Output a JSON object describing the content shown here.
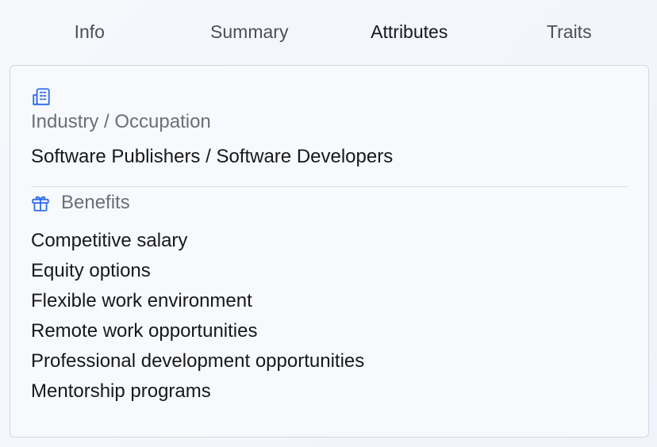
{
  "tabs": [
    {
      "label": "Info",
      "active": false
    },
    {
      "label": "Summary",
      "active": false
    },
    {
      "label": "Attributes",
      "active": true
    },
    {
      "label": "Traits",
      "active": false
    }
  ],
  "industry": {
    "icon": "building-icon",
    "label": "Industry / Occupation",
    "value": "Software Publishers / Software Developers"
  },
  "benefits": {
    "icon": "gift-icon",
    "label": "Benefits",
    "items": [
      "Competitive salary",
      "Equity options",
      "Flexible work environment",
      "Remote work opportunities",
      "Professional development opportunities",
      "Mentorship programs"
    ]
  },
  "colors": {
    "accent": "#2f6de6",
    "muted_text": "#6a6f78",
    "text": "#16181d",
    "border": "#d4d7de"
  }
}
